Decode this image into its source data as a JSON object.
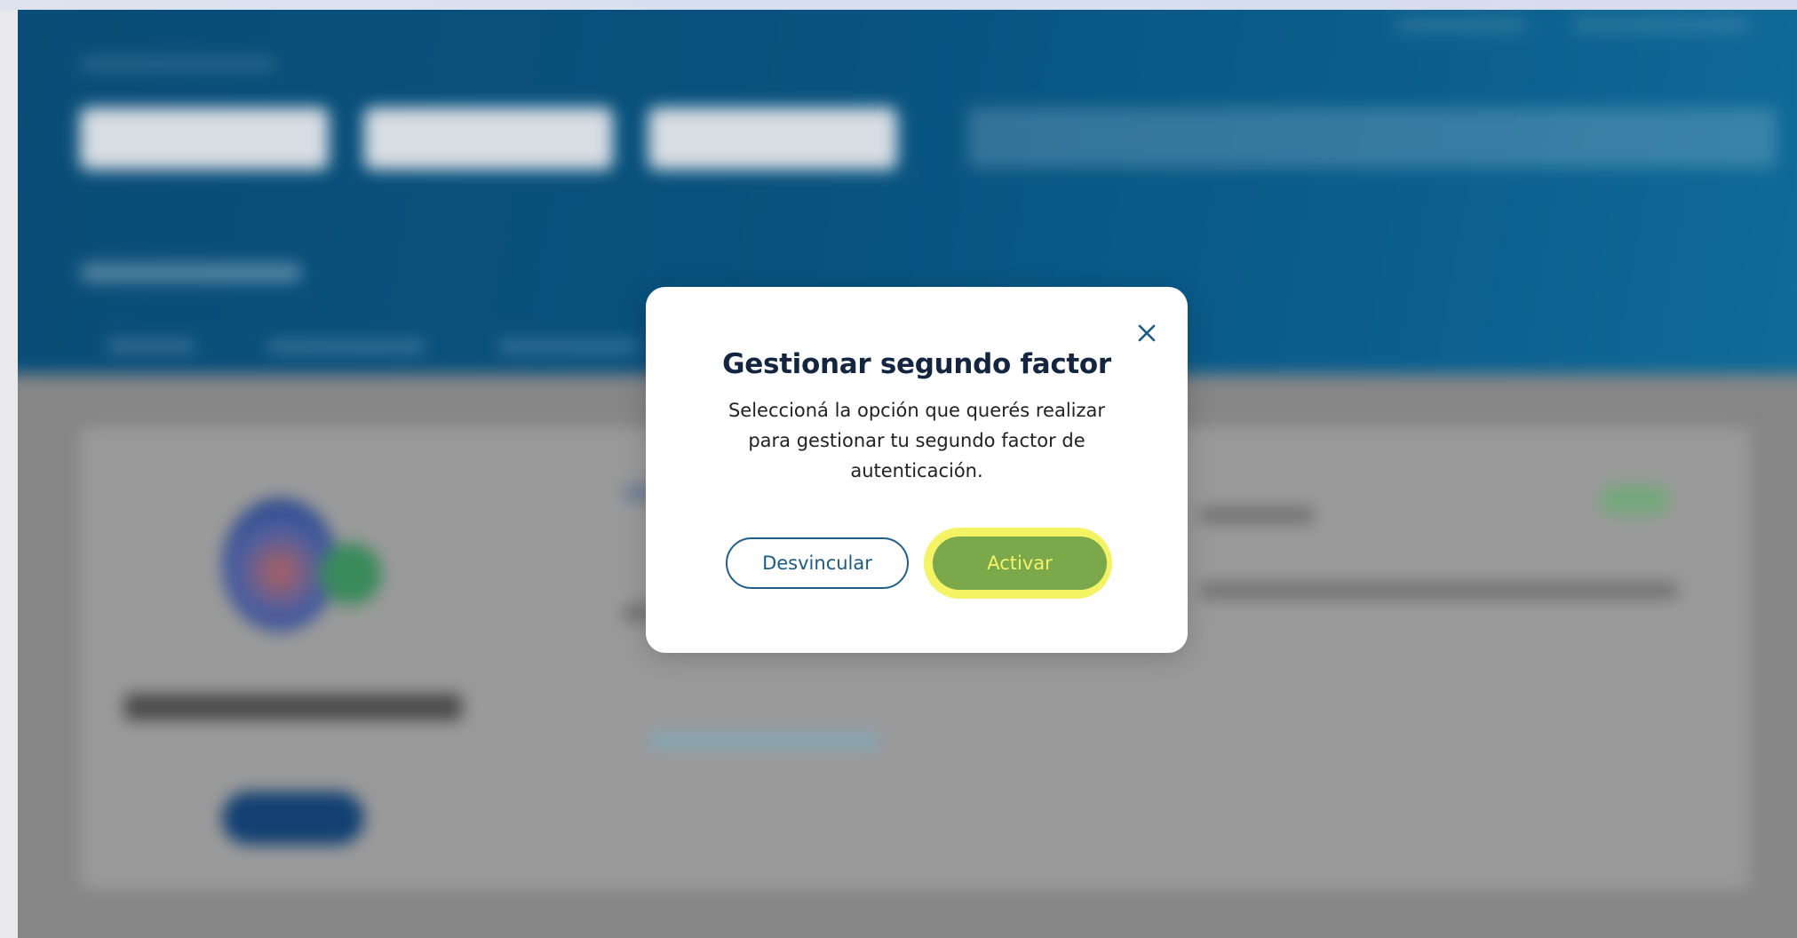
{
  "modal": {
    "title": "Gestionar segundo factor",
    "description": "Seleccioná la opción que querés realizar para gestionar tu segundo factor de autenticación.",
    "close_icon": "close-icon",
    "unlink_button_label": "Desvincular",
    "activate_button_label": "Activar"
  },
  "colors": {
    "header_blue": "#0a4d77",
    "primary_text": "#13253f",
    "activate_green": "#7aa84a",
    "highlight_yellow": "#f2f04a",
    "outline_blue": "#1f5f8a"
  }
}
